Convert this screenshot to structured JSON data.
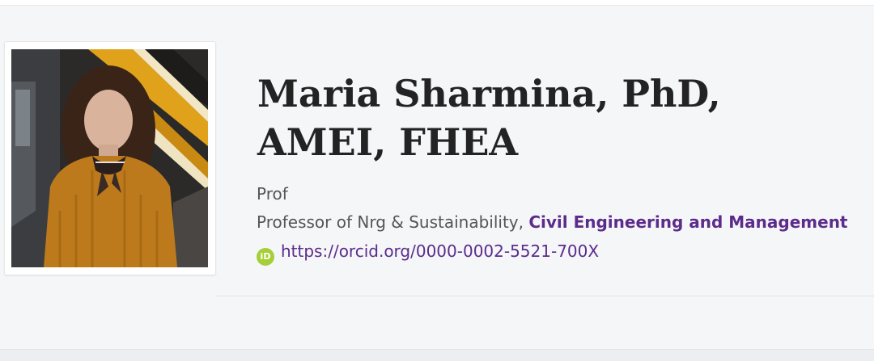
{
  "profile": {
    "name": "Maria Sharmina, PhD, AMEI, FHEA",
    "rank": "Prof",
    "position_title": "Professor of Nrg & Sustainability,",
    "department": "Civil Engineering and Management",
    "orcid_url": "https://orcid.org/0000-0002-5521-700X",
    "orcid_icon_text": "iD",
    "photo_icon": "profile-photo"
  },
  "colors": {
    "background": "#f5f6f8",
    "link": "#5b2c8b",
    "orcid_green": "#a6ce39",
    "heading": "#232323",
    "meta_text": "#555555"
  }
}
